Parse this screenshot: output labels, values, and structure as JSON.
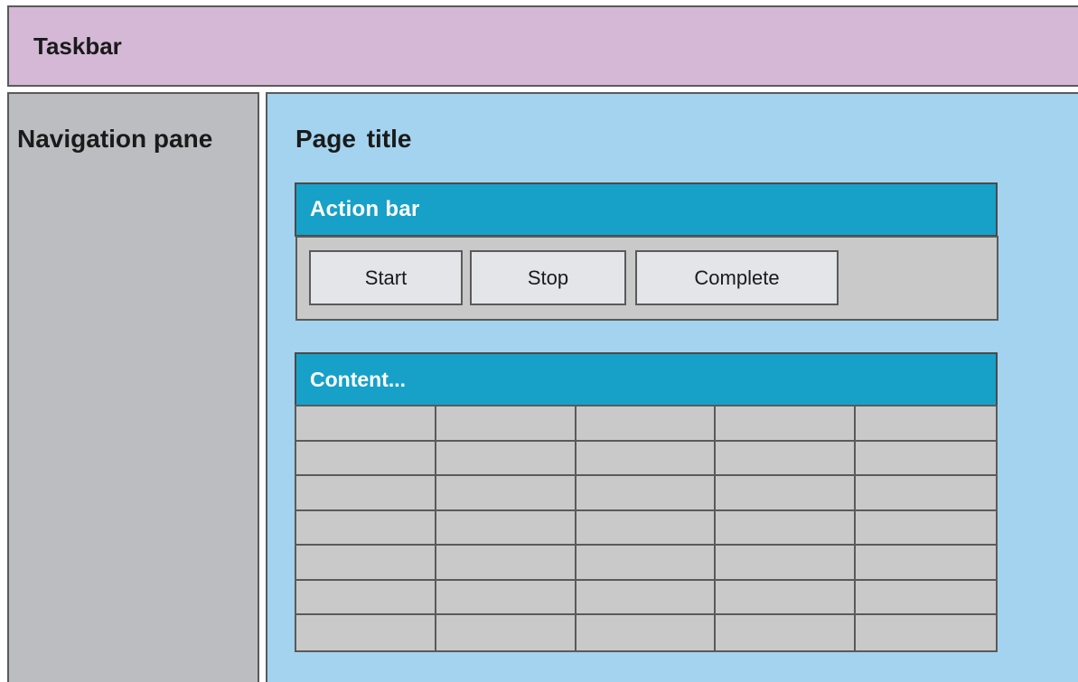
{
  "taskbar": {
    "title": "Taskbar",
    "background": "#d4b8d6"
  },
  "navigation": {
    "title": "Navigation pane",
    "background": "#bcbdc0"
  },
  "main": {
    "page_title": "Page title",
    "background": "#a3d3ee",
    "action_bar": {
      "title": "Action bar",
      "header_color": "#17a1c8",
      "buttons": [
        {
          "label": "Start"
        },
        {
          "label": "Stop"
        },
        {
          "label": "Complete"
        }
      ]
    },
    "content": {
      "title": "Content...",
      "header_color": "#17a1c8",
      "rows": 7,
      "columns": 5
    }
  }
}
